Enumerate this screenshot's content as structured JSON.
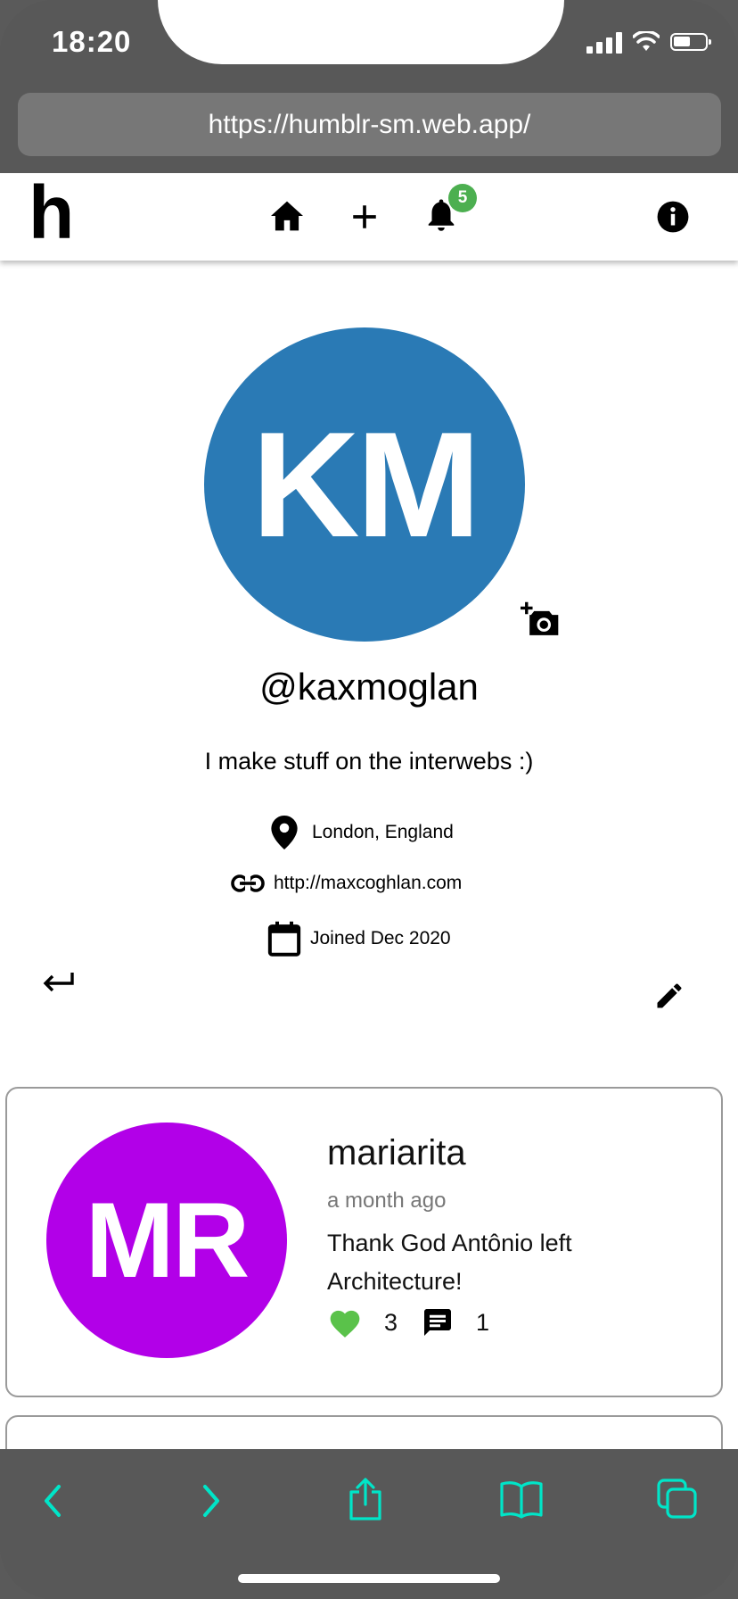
{
  "status_bar": {
    "time": "18:20"
  },
  "browser": {
    "url": "https://humblr-sm.web.app/"
  },
  "navbar": {
    "logo": "h",
    "notification_count": "5"
  },
  "profile": {
    "initials": "KM",
    "avatar_color": "#2a7ab5",
    "handle": "@kaxmoglan",
    "bio": "I make stuff on the interwebs :)",
    "location": "London, England",
    "website": "http://maxcoghlan.com",
    "joined": "Joined Dec 2020"
  },
  "posts": [
    {
      "initials": "MR",
      "avatar_color": "#b200e8",
      "author": "mariarita",
      "time": "a month ago",
      "body": "Thank God Antônio left Architecture!",
      "likes": "3",
      "comments": "1"
    }
  ],
  "colors": {
    "accent_green": "#5ac24a",
    "toolbar_icon": "#00e5c8"
  },
  "icons": [
    "home-icon",
    "plus-icon",
    "bell-icon",
    "info-icon",
    "add-photo-icon",
    "location-pin-icon",
    "link-icon",
    "calendar-icon",
    "return-icon",
    "edit-pencil-icon",
    "heart-icon",
    "comment-icon",
    "back-arrow-icon",
    "forward-arrow-icon",
    "share-icon",
    "bookmarks-icon",
    "tabs-icon"
  ]
}
